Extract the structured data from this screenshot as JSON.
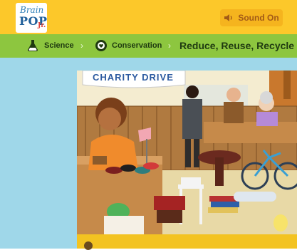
{
  "logo": {
    "brain": "Brain",
    "pop": "POP",
    "jr": "Jr."
  },
  "header": {
    "sound_label": "Sound On",
    "sound_icon": "speaker-icon"
  },
  "breadcrumb": {
    "items": [
      {
        "label": "Science",
        "icon": "flask-icon"
      },
      {
        "label": "Conservation",
        "icon": "conservation-icon"
      }
    ],
    "title": "Reduce, Reuse, Recycle"
  },
  "scene": {
    "banner_text": "CHARITY DRIVE"
  },
  "progress": {
    "value": 0.0
  },
  "colors": {
    "topbar": "#fcc82a",
    "breadcrumb_bar": "#8dc63f",
    "stage_background": "#9fd7e9",
    "progress_bar": "#f3c321"
  }
}
